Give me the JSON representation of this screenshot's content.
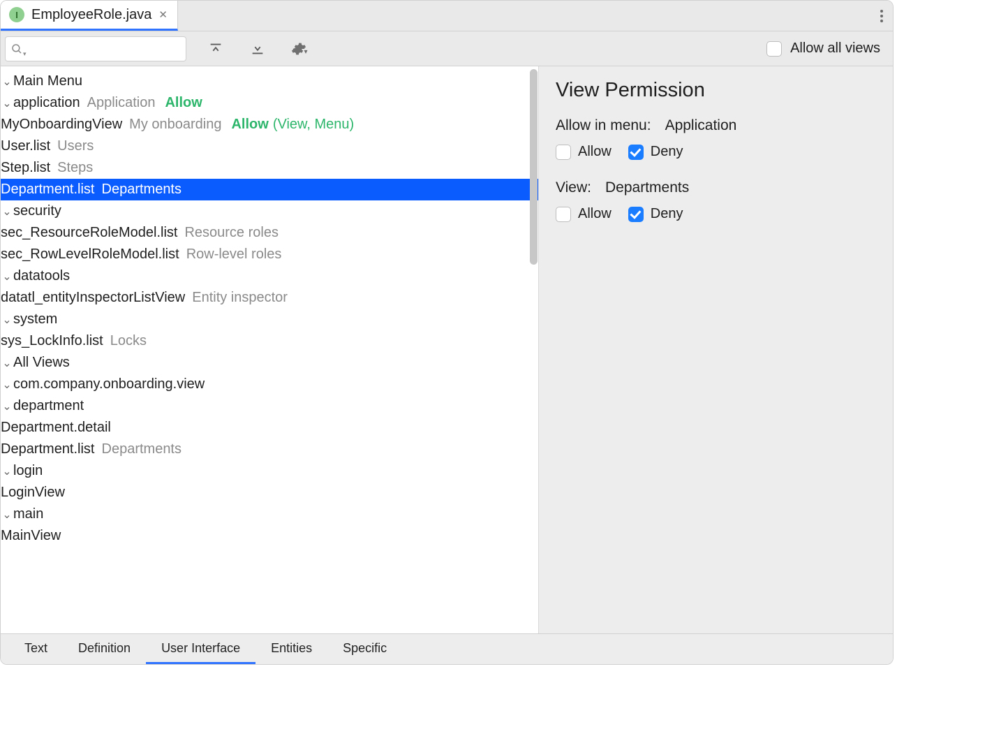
{
  "tab": {
    "filename": "EmployeeRole.java",
    "icon_letter": "I"
  },
  "toolbar": {
    "search_placeholder": "",
    "allow_all_label": "Allow all views",
    "allow_all_checked": false
  },
  "tree": {
    "r0": {
      "label": "Main Menu"
    },
    "r1": {
      "label": "application",
      "muted": "Application",
      "allow": "Allow"
    },
    "r2": {
      "label": "MyOnboardingView",
      "muted": "My onboarding",
      "allow": "Allow",
      "allow_extra": "(View, Menu)"
    },
    "r3": {
      "label": "User.list",
      "muted": "Users"
    },
    "r4": {
      "label": "Step.list",
      "muted": "Steps"
    },
    "r5": {
      "label": "Department.list",
      "muted": "Departments"
    },
    "r6": {
      "label": "security"
    },
    "r7": {
      "label": "sec_ResourceRoleModel.list",
      "muted": "Resource roles"
    },
    "r8": {
      "label": "sec_RowLevelRoleModel.list",
      "muted": "Row-level roles"
    },
    "r9": {
      "label": "datatools"
    },
    "r10": {
      "label": "datatl_entityInspectorListView",
      "muted": "Entity inspector"
    },
    "r11": {
      "label": "system"
    },
    "r12": {
      "label": "sys_LockInfo.list",
      "muted": "Locks"
    },
    "r13": {
      "label": "All Views"
    },
    "r14": {
      "label": "com.company.onboarding.view"
    },
    "r15": {
      "label": "department"
    },
    "r16": {
      "label": "Department.detail"
    },
    "r17": {
      "label": "Department.list",
      "muted": "Departments"
    },
    "r18": {
      "label": "login"
    },
    "r19": {
      "label": "LoginView"
    },
    "r20": {
      "label": "main"
    },
    "r21": {
      "label": "MainView"
    }
  },
  "right": {
    "title": "View Permission",
    "menu_label": "Allow in menu:",
    "menu_value": "Application",
    "menu_allow_label": "Allow",
    "menu_deny_label": "Deny",
    "menu_allow_checked": false,
    "menu_deny_checked": true,
    "view_label": "View:",
    "view_value": "Departments",
    "view_allow_label": "Allow",
    "view_deny_label": "Deny",
    "view_allow_checked": false,
    "view_deny_checked": true
  },
  "bottom_tabs": {
    "t0": "Text",
    "t1": "Definition",
    "t2": "User Interface",
    "t3": "Entities",
    "t4": "Specific",
    "active_index": 2
  }
}
